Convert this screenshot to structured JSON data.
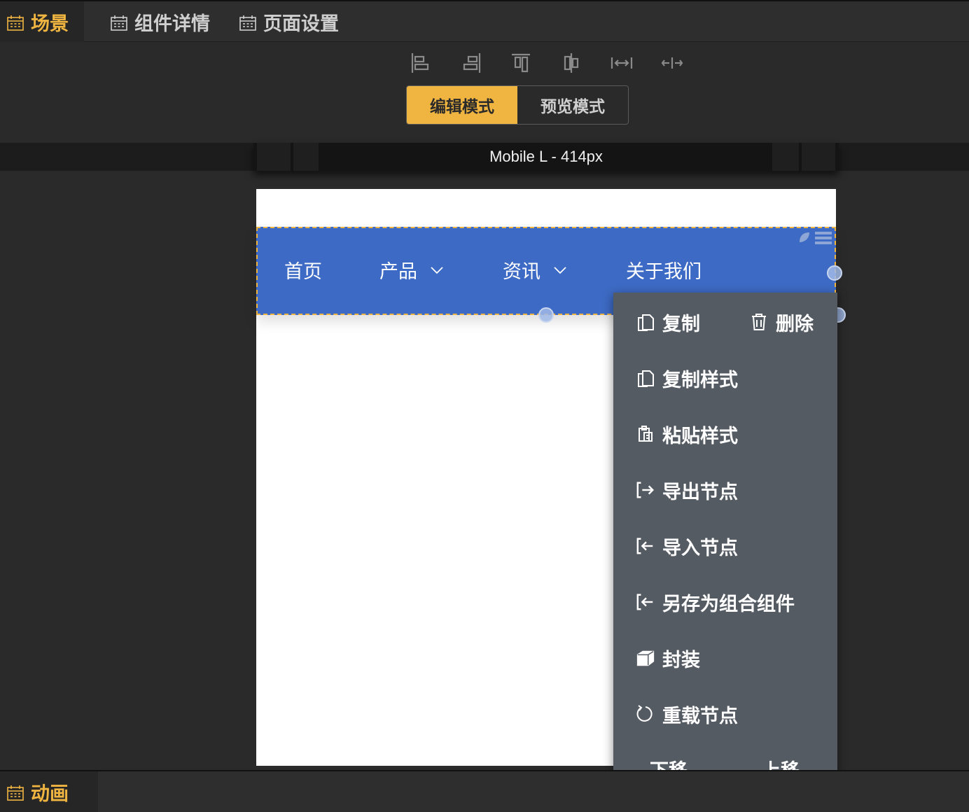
{
  "tabs": [
    {
      "label": "场景",
      "icon": "calendar-icon",
      "active": true
    },
    {
      "label": "组件详情",
      "icon": "calendar-icon",
      "active": false
    },
    {
      "label": "页面设置",
      "icon": "calendar-icon",
      "active": false
    }
  ],
  "toolbar": {
    "align_icons": [
      "align-left-icon",
      "align-right-icon",
      "align-top-icon",
      "align-vertical-center-icon",
      "distribute-horizontal-icon",
      "align-horizontal-center-icon"
    ],
    "modes": {
      "edit": "编辑模式",
      "preview": "预览模式"
    },
    "active_mode": "edit"
  },
  "device": {
    "label": "Mobile L - 414px"
  },
  "navbar": {
    "items": [
      {
        "label": "首页",
        "has_dropdown": false
      },
      {
        "label": "产品",
        "has_dropdown": true
      },
      {
        "label": "资讯",
        "has_dropdown": true
      },
      {
        "label": "关于我们",
        "has_dropdown": false
      }
    ],
    "background": "#3d6ac4"
  },
  "context_menu": {
    "copy": "复制",
    "delete": "删除",
    "copy_style": "复制样式",
    "paste_style": "粘贴样式",
    "export_node": "导出节点",
    "import_node": "导入节点",
    "save_as_group": "另存为组合组件",
    "wrap": "封装",
    "reload_node": "重载节点",
    "move_down": "下移",
    "move_up": "上移"
  },
  "bottom": {
    "tab_label": "动画"
  },
  "colors": {
    "accent": "#f0b541",
    "panel": "#2a2a2a",
    "menu": "#555b63"
  }
}
